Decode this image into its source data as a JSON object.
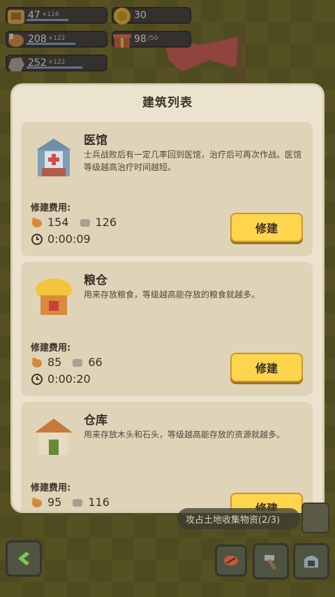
{
  "resources": {
    "troops": {
      "value": "47",
      "delta": "+116"
    },
    "gold": {
      "value": "30"
    },
    "food": {
      "value": "208",
      "delta": "+122"
    },
    "gift": {
      "value": "98",
      "cap": "/50"
    },
    "stone": {
      "value": "252",
      "delta": "+122"
    }
  },
  "panel": {
    "title": "建筑列表",
    "cost_label": "修建费用:",
    "build_label": "修建",
    "buildings": [
      {
        "name": "医馆",
        "desc": "士兵战败后有一定几率回到医馆，治疗后可再次作战。医馆等级越高治疗时间越短。",
        "wood": "154",
        "stone": "126",
        "time": "0:00:09"
      },
      {
        "name": "粮仓",
        "desc": "用来存放粮食，等级越高能存放的粮食就越多。",
        "wood": "85",
        "stone": "66",
        "time": "0:00:20"
      },
      {
        "name": "仓库",
        "desc": "用来存放木头和石头，等级越高能存放的资源就越多。",
        "wood": "95",
        "stone": "116",
        "time": ""
      }
    ]
  },
  "quest": {
    "text": "攻占土地收集物资(2/3)"
  },
  "colors": {
    "button": "#ffd54d",
    "panel": "#ece3cf",
    "card": "#e0d4b8"
  },
  "icons": [
    "troops-icon",
    "gold-coin-icon",
    "food-icon",
    "gift-icon",
    "stone-icon",
    "wood-icon",
    "clock-icon",
    "back-arrow-icon",
    "meat-icon",
    "hammer-icon",
    "helmet-icon",
    "scroll-icon"
  ]
}
